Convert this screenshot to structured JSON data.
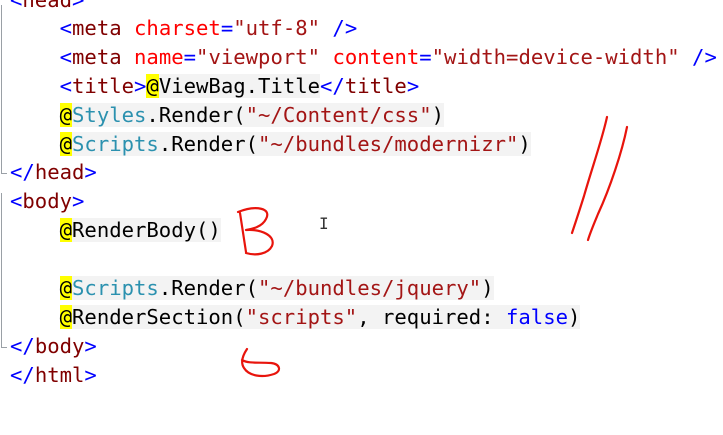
{
  "editor": {
    "lines": [
      [
        {
          "t": "<",
          "k": "bracket"
        },
        {
          "t": "head",
          "k": "tag"
        },
        {
          "t": ">",
          "k": "bracket"
        }
      ],
      [
        {
          "t": "    ",
          "k": "text"
        },
        {
          "t": "<",
          "k": "bracket"
        },
        {
          "t": "meta",
          "k": "tag"
        },
        {
          "t": " ",
          "k": "text"
        },
        {
          "t": "charset",
          "k": "attr"
        },
        {
          "t": "=",
          "k": "eq"
        },
        {
          "t": "\"utf-8\"",
          "k": "str"
        },
        {
          "t": " />",
          "k": "bracket"
        }
      ],
      [
        {
          "t": "    ",
          "k": "text"
        },
        {
          "t": "<",
          "k": "bracket"
        },
        {
          "t": "meta",
          "k": "tag"
        },
        {
          "t": " ",
          "k": "text"
        },
        {
          "t": "name",
          "k": "attr"
        },
        {
          "t": "=",
          "k": "eq"
        },
        {
          "t": "\"viewport\"",
          "k": "str"
        },
        {
          "t": " ",
          "k": "text"
        },
        {
          "t": "content",
          "k": "attr"
        },
        {
          "t": "=",
          "k": "eq"
        },
        {
          "t": "\"width=device-width\"",
          "k": "str"
        },
        {
          "t": " />",
          "k": "bracket"
        }
      ],
      [
        {
          "t": "    ",
          "k": "text"
        },
        {
          "t": "<",
          "k": "bracket"
        },
        {
          "t": "title",
          "k": "tag"
        },
        {
          "t": ">",
          "k": "bracket"
        },
        {
          "t": "@",
          "k": "at"
        },
        {
          "t": "ViewBag.Title",
          "k": "razor"
        },
        {
          "t": "</",
          "k": "bracket"
        },
        {
          "t": "title",
          "k": "tag"
        },
        {
          "t": ">",
          "k": "bracket"
        }
      ],
      [
        {
          "t": "    ",
          "k": "text"
        },
        {
          "t": "@",
          "k": "at"
        },
        {
          "t": "Styles",
          "k": "type-razor"
        },
        {
          "t": ".Render(",
          "k": "razor"
        },
        {
          "t": "\"~/Content/css\"",
          "k": "str-razor"
        },
        {
          "t": ")",
          "k": "razor"
        }
      ],
      [
        {
          "t": "    ",
          "k": "text"
        },
        {
          "t": "@",
          "k": "at"
        },
        {
          "t": "Scripts",
          "k": "type-razor"
        },
        {
          "t": ".Render(",
          "k": "razor"
        },
        {
          "t": "\"~/bundles/modernizr\"",
          "k": "str-razor"
        },
        {
          "t": ")",
          "k": "razor"
        }
      ],
      [
        {
          "t": "</",
          "k": "bracket"
        },
        {
          "t": "head",
          "k": "tag"
        },
        {
          "t": ">",
          "k": "bracket"
        }
      ],
      [
        {
          "t": "<",
          "k": "bracket"
        },
        {
          "t": "body",
          "k": "tag"
        },
        {
          "t": ">",
          "k": "bracket"
        }
      ],
      [
        {
          "t": "    ",
          "k": "text"
        },
        {
          "t": "@",
          "k": "at"
        },
        {
          "t": "RenderBody()",
          "k": "razor"
        }
      ],
      [],
      [
        {
          "t": "    ",
          "k": "text"
        },
        {
          "t": "@",
          "k": "at"
        },
        {
          "t": "Scripts",
          "k": "type-razor"
        },
        {
          "t": ".Render(",
          "k": "razor"
        },
        {
          "t": "\"~/bundles/jquery\"",
          "k": "str-razor"
        },
        {
          "t": ")",
          "k": "razor"
        }
      ],
      [
        {
          "t": "    ",
          "k": "text"
        },
        {
          "t": "@",
          "k": "at"
        },
        {
          "t": "RenderSection(",
          "k": "razor"
        },
        {
          "t": "\"scripts\"",
          "k": "str-razor"
        },
        {
          "t": ", required: ",
          "k": "razor"
        },
        {
          "t": "false",
          "k": "kw-razor"
        },
        {
          "t": ")",
          "k": "razor"
        }
      ],
      [
        {
          "t": "</",
          "k": "bracket"
        },
        {
          "t": "body",
          "k": "tag"
        },
        {
          "t": ">",
          "k": "bracket"
        }
      ],
      [
        {
          "t": "</",
          "k": "bracket"
        },
        {
          "t": "html",
          "k": "tag"
        },
        {
          "t": ">",
          "k": "bracket"
        }
      ]
    ],
    "text_cursor_glyph": "I",
    "colors": {
      "tag": "#800000",
      "bracket": "#0000ff",
      "attribute": "#ff0000",
      "string": "#a31515",
      "keyword": "#0000ff",
      "type": "#2b91af",
      "razor_highlight": "#ffff00",
      "razor_background": "#f3f3f3",
      "annotation_ink": "#e8140c"
    }
  }
}
